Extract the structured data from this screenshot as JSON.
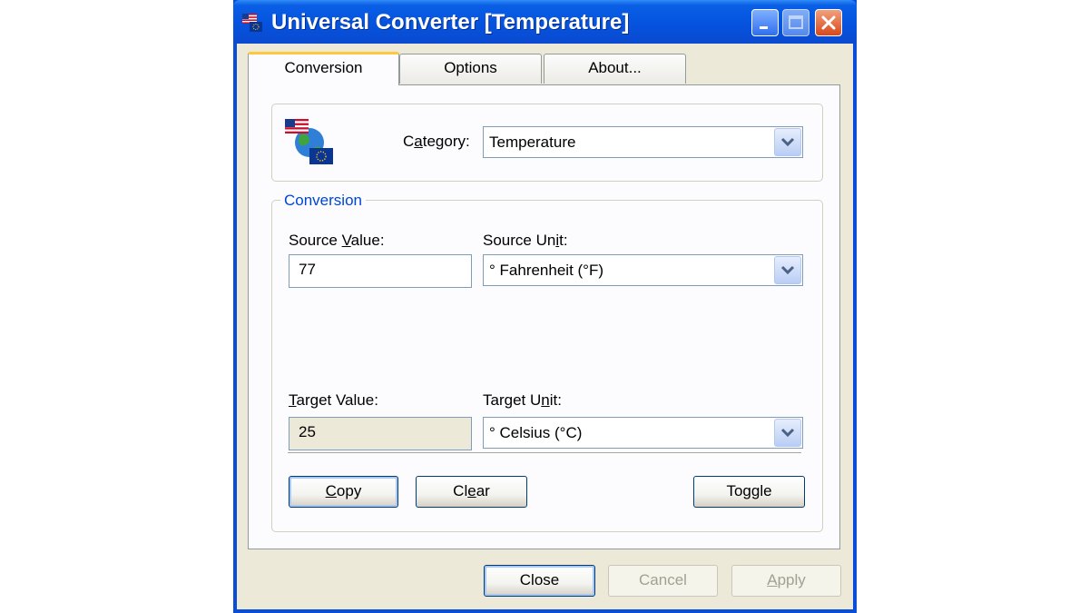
{
  "window": {
    "title": "Universal Converter [Temperature]"
  },
  "tabs": [
    {
      "label": "Conversion",
      "active": true
    },
    {
      "label": "Options",
      "active": false
    },
    {
      "label": "About...",
      "active": false
    }
  ],
  "category": {
    "label_pre": "C",
    "label_u": "a",
    "label_post": "tegory:",
    "selected": "Temperature"
  },
  "conversion_group": {
    "legend": "Conversion"
  },
  "source": {
    "value_label_pre": "Source ",
    "value_label_u": "V",
    "value_label_post": "alue:",
    "value": "77",
    "unit_label_pre": "Source Un",
    "unit_label_u": "i",
    "unit_label_post": "t:",
    "unit": "° Fahrenheit (°F)"
  },
  "target": {
    "value_label_pre": "",
    "value_label_u": "T",
    "value_label_post": "arget Value:",
    "value": "25",
    "unit_label_pre": "Target U",
    "unit_label_u": "n",
    "unit_label_post": "it:",
    "unit": "° Celsius (°C)"
  },
  "actions": {
    "copy_u": "C",
    "copy_rest": "opy",
    "clear_pre": "Cl",
    "clear_u": "e",
    "clear_post": "ar",
    "toggle_pre": "To",
    "toggle_u": "g",
    "toggle_post": "gle"
  },
  "footer": {
    "close_label": "Close",
    "cancel_label": "Cancel",
    "apply_u": "A",
    "apply_rest": "pply"
  },
  "colors": {
    "titlebar": "#0553de",
    "face": "#ece9d8",
    "legend": "#0046d5",
    "tab_highlight": "#ffc83c"
  },
  "icons": [
    "flags-globe-icon",
    "minimize-icon",
    "maximize-icon",
    "close-icon",
    "chevron-down-icon"
  ]
}
